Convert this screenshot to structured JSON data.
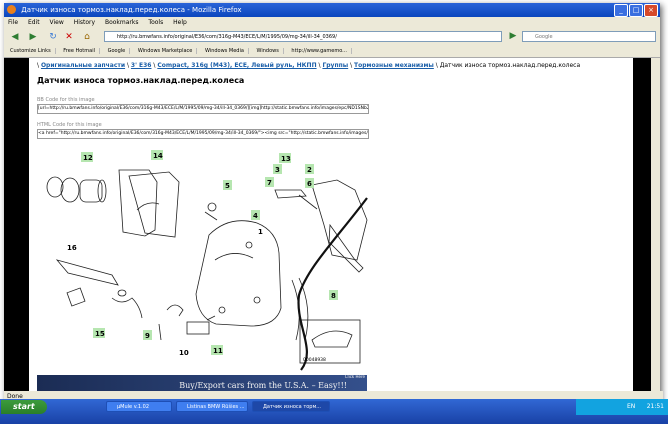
{
  "window": {
    "title": "Датчик износа тормоз.наклад.перед.колеса - Mozilla Firefox"
  },
  "menu": [
    "File",
    "Edit",
    "View",
    "History",
    "Bookmarks",
    "Tools",
    "Help"
  ],
  "nav": {
    "url": "http://ru.bmwfans.info/original/E36/com/316g-M43/ECE/L/M/1995/09/mg-34/ill-34_0369/",
    "search_placeholder": "Google"
  },
  "bookmarks": [
    "Customize Links",
    "Free Hotmail",
    "Google",
    "Windows Marketplace",
    "Windows Media",
    "Windows",
    "http://www.gamemo..."
  ],
  "page": {
    "breadcrumb": [
      "Оригинальные запчасти",
      "3' E36",
      "Compact, 316g (M43), ECE, Левый руль, НКПП",
      "Группы",
      "Тормозные механизмы",
      "Датчик износа тормоз.наклад.перед.колеса"
    ],
    "heading": "Датчик износа тормоз.наклад.перед.колеса",
    "bb_label": "BB Code for this image",
    "bb_code": "[url=http://ru.bmwfans.info/original/E36/com/316g-M43/ECE/L/M/1995/09/mg-34/ill-34_0369/][img]http://static.bmwfans.info/images/epc/ND1SNb2E",
    "html_label": "HTML Code for this image",
    "html_code": "<a href=\"http://ru.bmwfans.info/original/E36/com/316g-M43/ECE/L/M/1995/09/mg-34/ill-34_0369/\"><img src=\"http://static.bmwfans.info/images/epc",
    "part_numbers": [
      "12",
      "14",
      "16",
      "1",
      "13",
      "7",
      "2",
      "3",
      "5",
      "4",
      "6",
      "15",
      "9",
      "10",
      "11",
      "8"
    ],
    "diagram_code": "00048938",
    "banner_text": "Buy/Export cars from the U.S.A. – Easy!!!",
    "banner_small": "Click Here"
  },
  "status": "Done",
  "taskbar": {
    "start": "start",
    "tasks": [
      "µMule v.1.02",
      "Listinas BMW Rūšies ...",
      "Датчик износа торм..."
    ],
    "lang": "EN",
    "clock": "21:51"
  }
}
